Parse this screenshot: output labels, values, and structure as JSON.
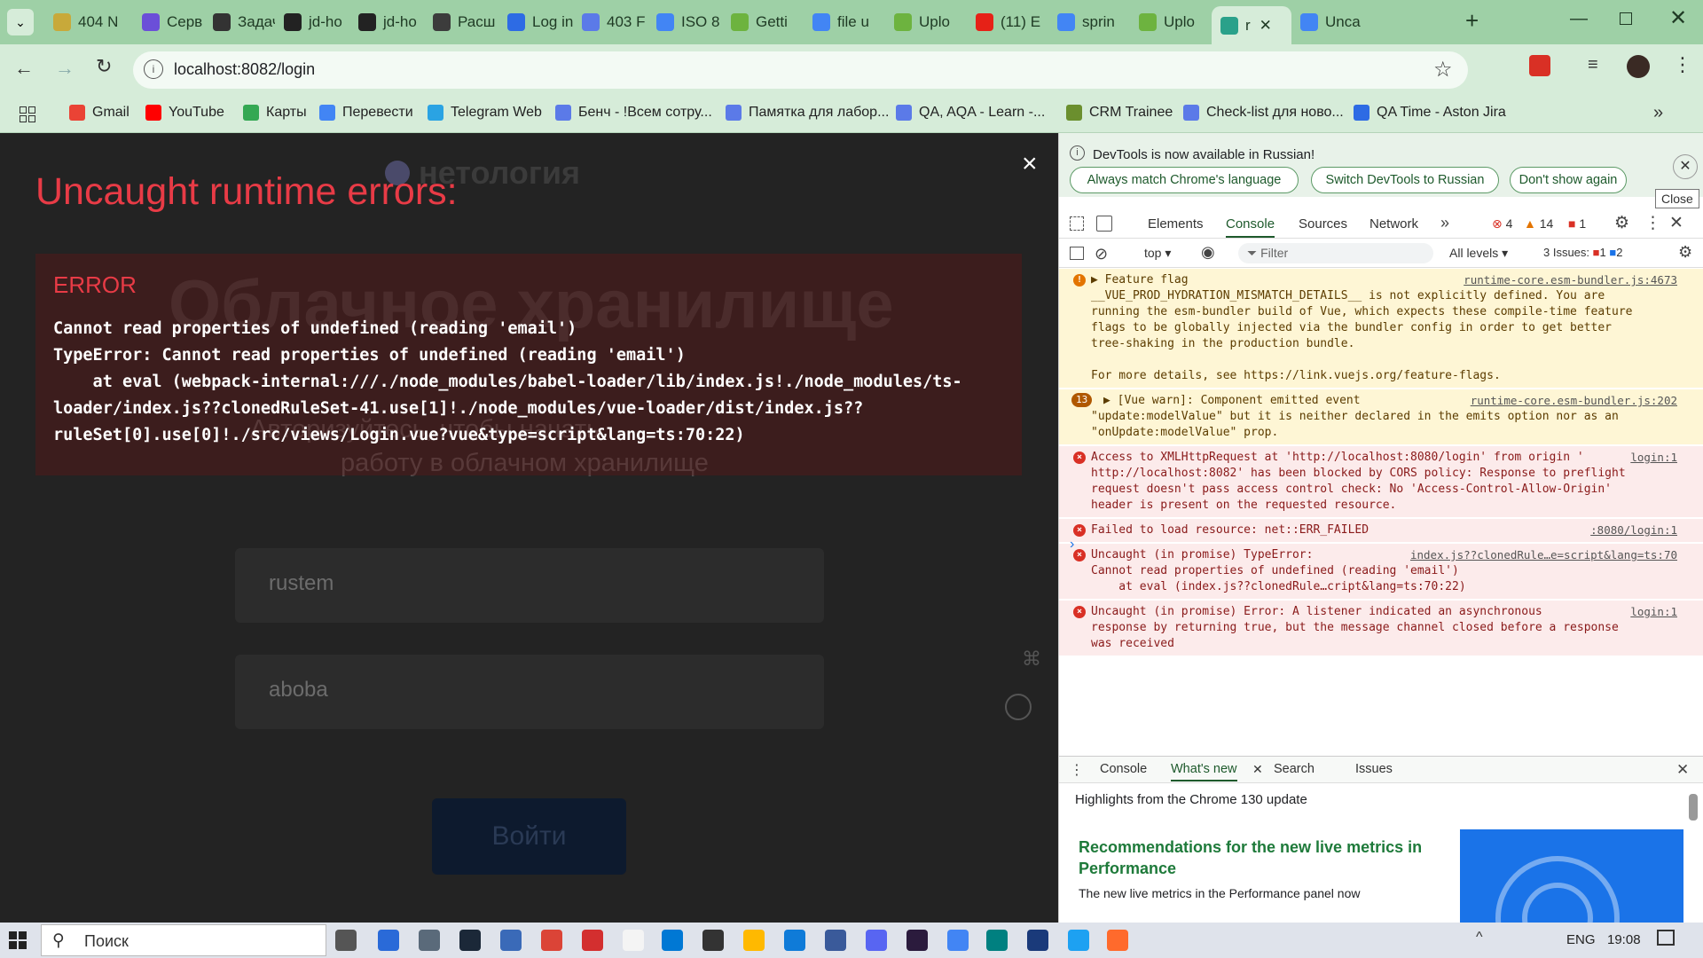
{
  "tabs": [
    {
      "label": "404 N",
      "color": "#c8a93a"
    },
    {
      "label": "Серв",
      "color": "#6b4fd8"
    },
    {
      "label": "Задач",
      "color": "#333"
    },
    {
      "label": "jd-ho",
      "color": "#222"
    },
    {
      "label": "jd-ho",
      "color": "#222"
    },
    {
      "label": "Расш",
      "color": "#3c3c3c"
    },
    {
      "label": "Log in",
      "color": "#2d6be4"
    },
    {
      "label": "403 F",
      "color": "#5b7ae8"
    },
    {
      "label": "ISO 8",
      "color": "#4285f4"
    },
    {
      "label": "Getti",
      "color": "#6db33f"
    },
    {
      "label": "file u",
      "color": "#4285f4"
    },
    {
      "label": "Uplo",
      "color": "#6db33f"
    },
    {
      "label": "(11) E",
      "color": "#e62117"
    },
    {
      "label": "sprin",
      "color": "#4285f4"
    },
    {
      "label": "Uplo",
      "color": "#6db33f"
    },
    {
      "label": "r",
      "color": "#2aa18a"
    },
    {
      "label": "Unca",
      "color": "#4285f4"
    }
  ],
  "address": {
    "url": "localhost:8082/login"
  },
  "bookmarks": [
    "Gmail",
    "YouTube",
    "Карты",
    "Перевести",
    "Telegram Web",
    "Бенч - !Всем сотру...",
    "Памятка для лабор...",
    "QA, AQA - Learn -...",
    "CRM Trainee",
    "Check-list для ново...",
    "QA Time - Aston Jira"
  ],
  "bookmark_colors": [
    "#ea4335",
    "#ff0000",
    "#34a853",
    "#4285f4",
    "#2aa3e3",
    "#5b7ae8",
    "#5b7ae8",
    "#5b7ae8",
    "#6b8f2e",
    "#5b7ae8",
    "#2d6be4"
  ],
  "app": {
    "logo": "нетология",
    "heading": "Облачное хранилище",
    "subtitle_line1": "Авторизуйтесь, чтобы начать",
    "subtitle_line2": "работу в облачном хранилище",
    "login_value": "rustem",
    "password_value": "aboba",
    "submit_label": "Войти"
  },
  "overlay": {
    "title": "Uncaught runtime errors:",
    "close": "×",
    "error_label": "ERROR",
    "lines": [
      "Cannot read properties of undefined (reading 'email')",
      "TypeError: Cannot read properties of undefined (reading 'email')",
      "    at eval (webpack-internal:///./node_modules/babel-loader/lib/index.js!./node_modules/ts-",
      "loader/index.js??clonedRuleSet-41.use[1]!./node_modules/vue-loader/dist/index.js??",
      "ruleSet[0].use[0]!./src/views/Login.vue?vue&type=script&lang=ts:70:22)"
    ]
  },
  "devtools": {
    "notice": "DevTools is now available in Russian!",
    "notice_buttons": [
      "Always match Chrome's language",
      "Switch DevTools to Russian",
      "Don't show again"
    ],
    "tooltip": "Close",
    "tabs": [
      "Elements",
      "Console",
      "Sources",
      "Network"
    ],
    "counts": {
      "errors": "4",
      "warnings": "14",
      "issues_flag": "1"
    },
    "context": "top",
    "filter_placeholder": "Filter",
    "levels": "All levels",
    "issues_label": "3 Issues:",
    "issues_err": "1",
    "issues_info": "2",
    "messages": [
      {
        "kind": "warn",
        "lines": [
          "▶ Feature flag",
          "__VUE_PROD_HYDRATION_MISMATCH_DETAILS__ is not explicitly defined. You are",
          "running the esm-bundler build of Vue, which expects these compile-time feature",
          "flags to be globally injected via the bundler config in order to get better",
          "tree-shaking in the production bundle.",
          "",
          "For more details, see https://link.vuejs.org/feature-flags."
        ],
        "source": "runtime-core.esm-bundler.js:4673"
      },
      {
        "kind": "warn",
        "badge": "13",
        "lines": [
          "▶ [Vue warn]: Component emitted event",
          "\"update:modelValue\" but it is neither declared in the emits option nor as an",
          "\"onUpdate:modelValue\" prop."
        ],
        "source": "runtime-core.esm-bundler.js:202"
      },
      {
        "kind": "err",
        "lines": [
          "Access to XMLHttpRequest at 'http://localhost:8080/login' from origin '",
          "http://localhost:8082' has been blocked by CORS policy: Response to preflight",
          "request doesn't pass access control check: No 'Access-Control-Allow-Origin'",
          "header is present on the requested resource."
        ],
        "source": "login:1"
      },
      {
        "kind": "err",
        "lines": [
          "Failed to load resource: net::ERR_FAILED"
        ],
        "source": ":8080/login:1"
      },
      {
        "kind": "err",
        "lines": [
          "Uncaught (in promise) TypeError:",
          "Cannot read properties of undefined (reading 'email')",
          "    at eval (index.js??clonedRule…cript&lang=ts:70:22)"
        ],
        "source": "index.js??clonedRule…e=script&lang=ts:70"
      },
      {
        "kind": "err",
        "lines": [
          "Uncaught (in promise) Error: A listener indicated an asynchronous",
          "response by returning true, but the message channel closed before a response",
          "was received"
        ],
        "source": "login:1"
      }
    ],
    "drawer_tabs": [
      "Console",
      "What's new",
      "Search",
      "Issues"
    ],
    "whats_new_title": "Highlights from the Chrome 130 update",
    "article_title": "Recommendations for the new live metrics in Performance",
    "article_text": "The new live metrics in the Performance panel now"
  },
  "taskbar": {
    "search": "Поиск",
    "lang": "ENG",
    "time": "19:08"
  }
}
